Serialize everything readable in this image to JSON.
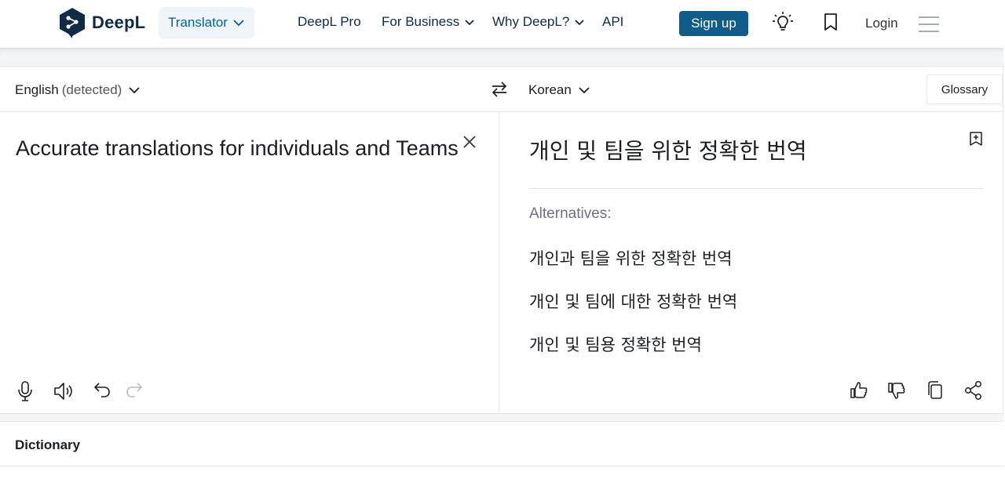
{
  "header": {
    "brand": "DeepL",
    "translator_label": "Translator",
    "nav": {
      "deepl_pro": "DeepL Pro",
      "for_business": "For Business",
      "why_deepl": "Why DeepL?",
      "api": "API"
    },
    "signup_label": "Sign up",
    "login_label": "Login",
    "icons": [
      "lightbulb-icon",
      "bookmark-icon",
      "hamburger-menu-icon"
    ]
  },
  "translator": {
    "source_language": "English",
    "source_detected": "(detected)",
    "target_language": "Korean",
    "glossary_label": "Glossary",
    "source_text": "Accurate translations for individuals and Teams",
    "target_text": "개인 및 팀을 위한 정확한 번역",
    "alternatives_label": "Alternatives:",
    "alternatives": [
      "개인과 팀을 위한 정확한 번역",
      "개인 및 팀에 대한 정확한 번역",
      "개인 및 팀용 정확한 번역"
    ],
    "source_tools": [
      "microphone-icon",
      "speaker-icon",
      "undo-icon",
      "redo-icon"
    ],
    "target_tools": [
      "thumbs-up-icon",
      "thumbs-down-icon",
      "copy-icon",
      "share-icon"
    ]
  },
  "dictionary": {
    "title": "Dictionary"
  },
  "colors": {
    "brand_navy": "#0f2b46",
    "accent_blue": "#006494",
    "signup_bg": "#0f5c8a",
    "pill_bg": "#eef4f8"
  }
}
